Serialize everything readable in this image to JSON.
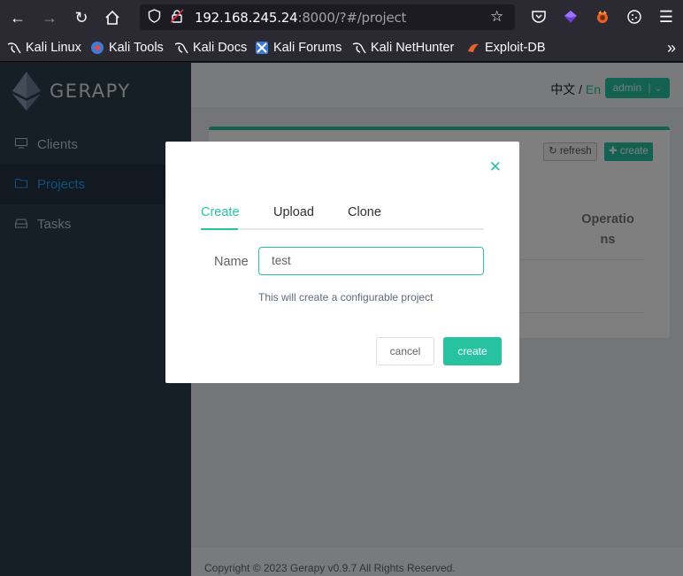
{
  "browser": {
    "url_host": "192.168.245.24",
    "url_rest": ":8000/?#/project",
    "bookmarks": [
      "Kali Linux",
      "Kali Tools",
      "Kali Docs",
      "Kali Forums",
      "Kali NetHunter",
      "Exploit-DB"
    ]
  },
  "app": {
    "brand": "GERAPY",
    "menu": [
      {
        "label": "Clients",
        "icon": "monitor-icon"
      },
      {
        "label": "Projects",
        "icon": "folder-icon",
        "active": true
      },
      {
        "label": "Tasks",
        "icon": "hdd-icon"
      }
    ],
    "header": {
      "lang_zh": "中文",
      "lang_sep": "/",
      "lang_en": "En",
      "user": "admin"
    },
    "card": {
      "refresh_label": "refresh",
      "create_label": "create",
      "col_operations_1": "Operatio",
      "col_operations_2": "ns"
    },
    "footer": "Copyright © 2023 Gerapy v0.9.7 All Rights Reserved."
  },
  "modal": {
    "tabs": [
      "Create",
      "Upload",
      "Clone"
    ],
    "active_tab": "Create",
    "name_label": "Name",
    "name_value": "test",
    "hint": "This will create a configurable project",
    "cancel_label": "cancel",
    "create_label": "create"
  },
  "colors": {
    "accent": "#27c3a0",
    "sidebar": "#2f3e4d",
    "active_menu": "#20a0ff"
  }
}
